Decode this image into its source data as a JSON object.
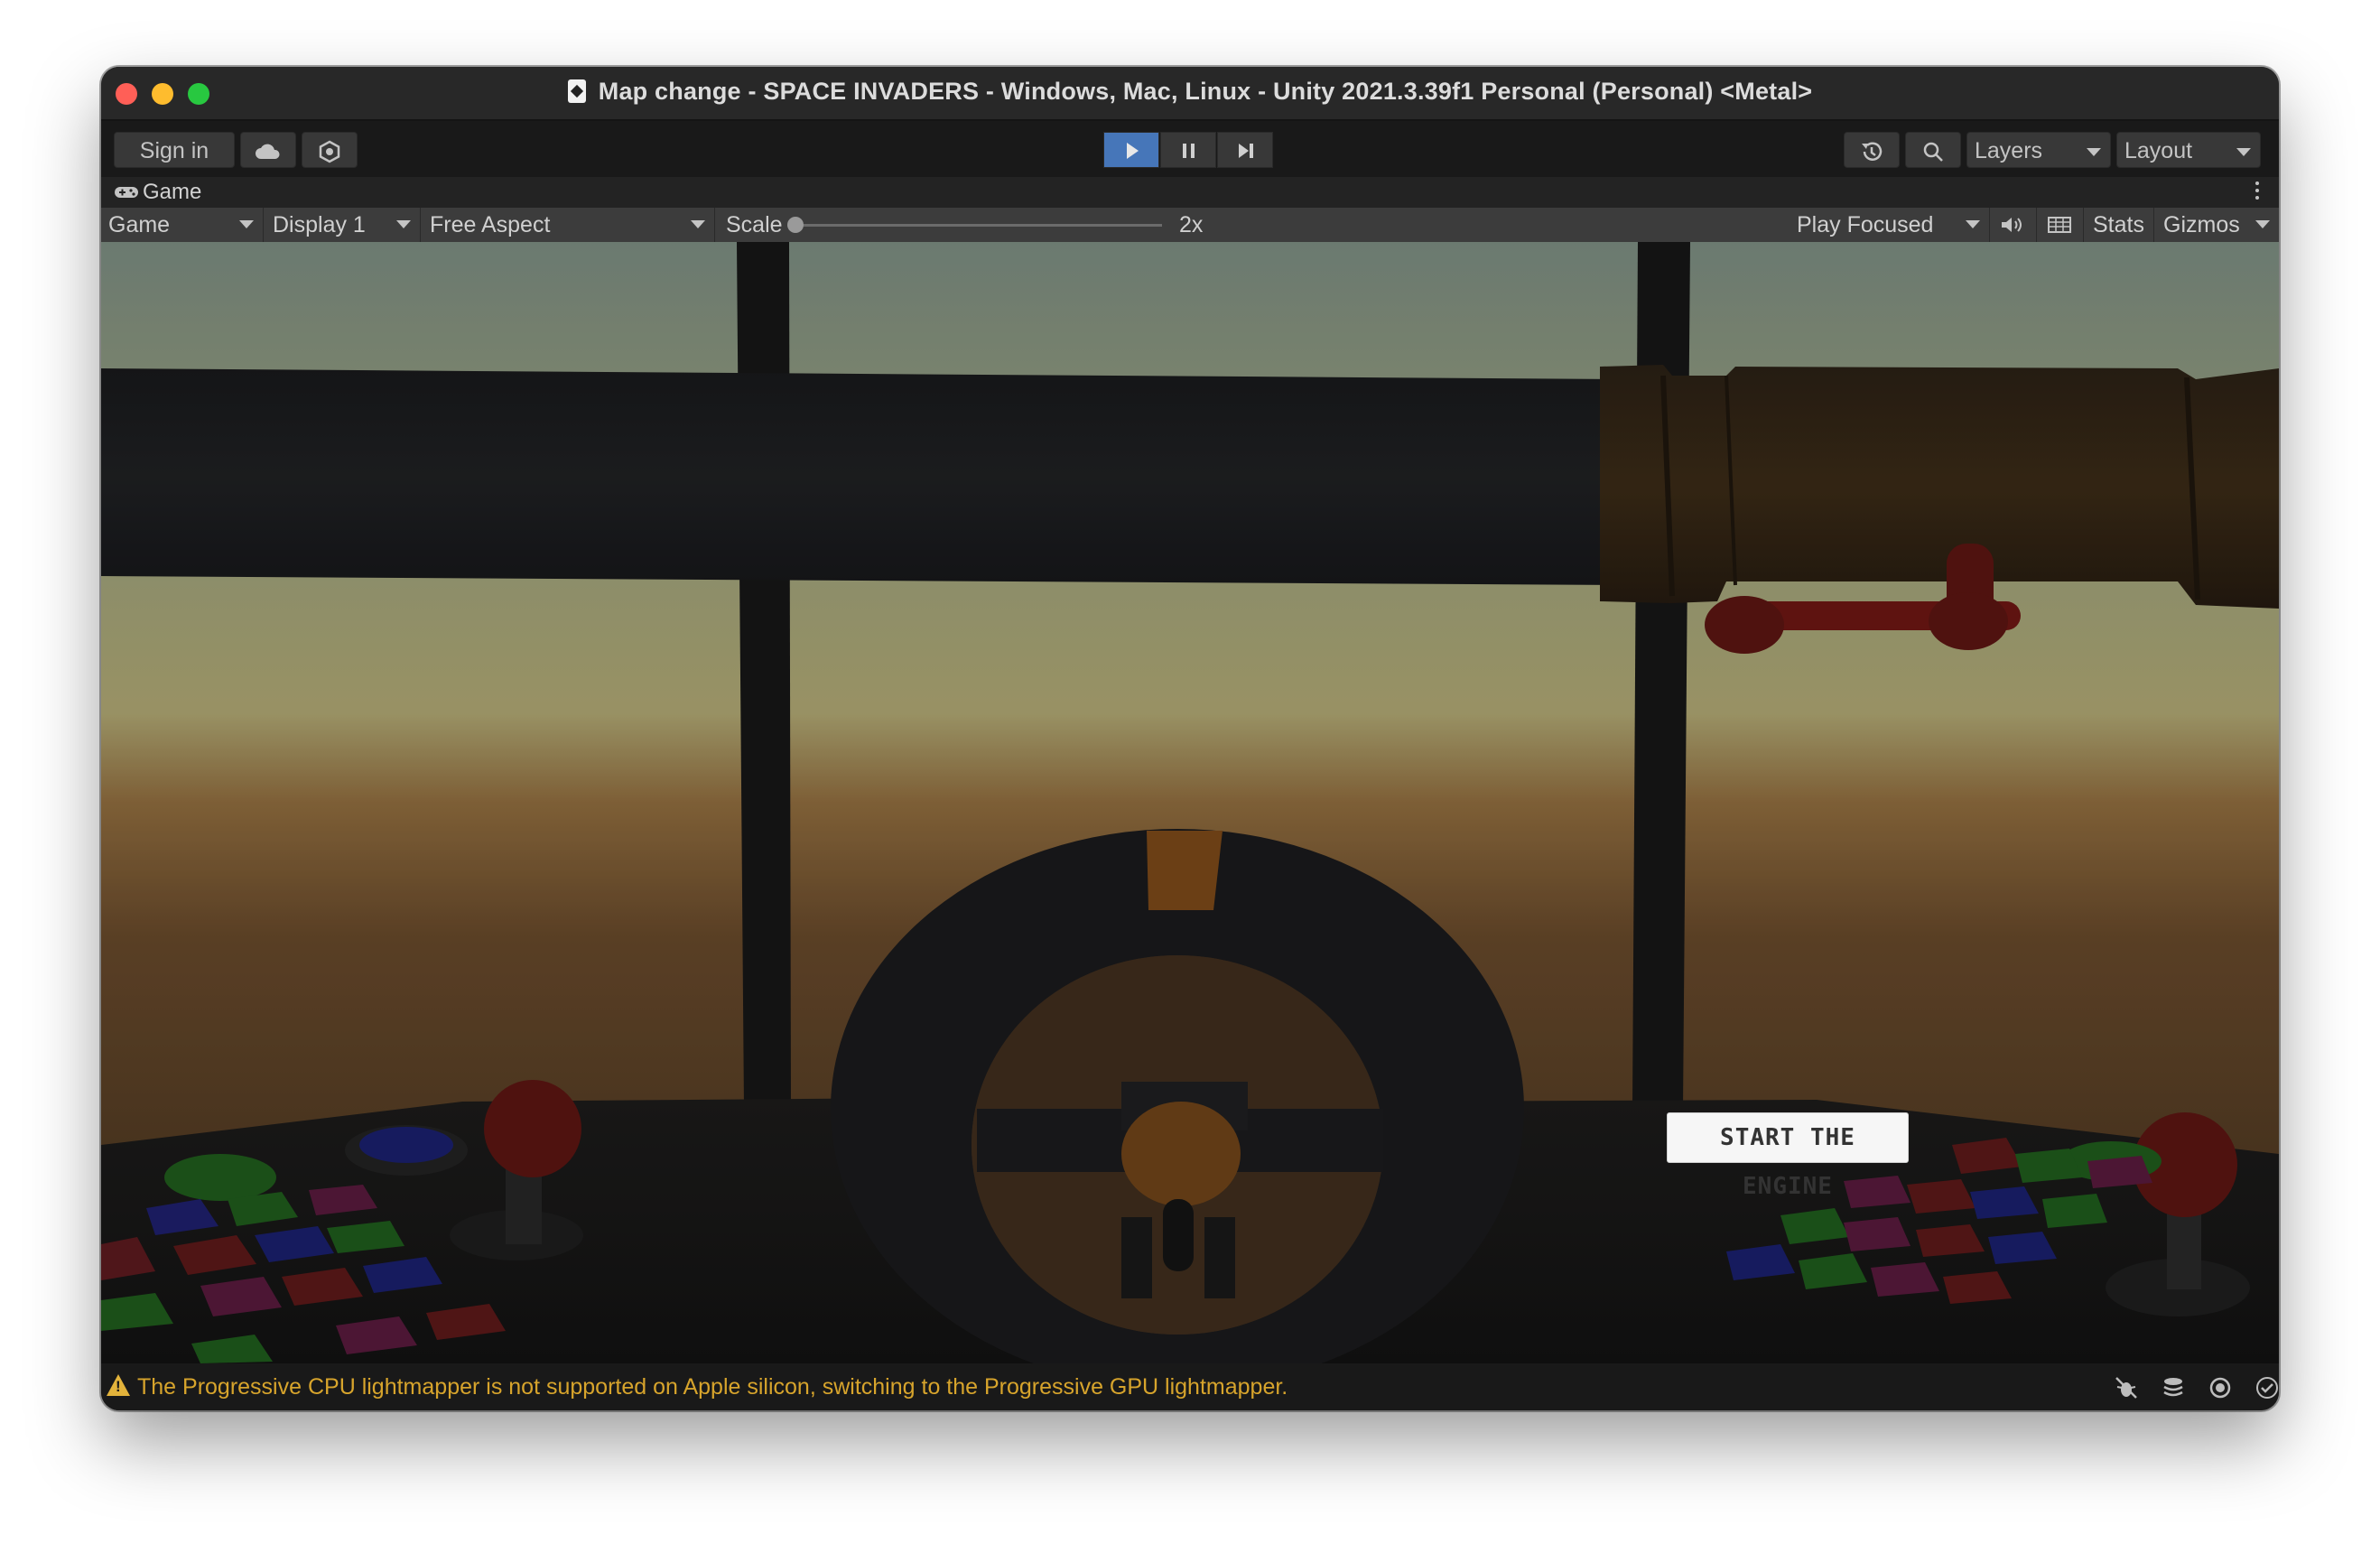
{
  "window": {
    "title": "Map change - SPACE INVADERS - Windows, Mac, Linux - Unity 2021.3.39f1 Personal (Personal) <Metal>"
  },
  "toolbar": {
    "sign_in_label": "Sign in",
    "cloud_icon": "cloud-icon",
    "collab_icon": "collab-icon",
    "play_icon": "play-icon",
    "pause_icon": "pause-icon",
    "step_icon": "step-icon",
    "history_icon": "history-icon",
    "search_icon": "search-icon",
    "layers_label": "Layers",
    "layout_label": "Layout",
    "play_active_color": "#4676b9"
  },
  "game_tab": {
    "label": "Game",
    "icon": "gamepad-icon"
  },
  "game_toolbar": {
    "mode": "Game",
    "display": "Display 1",
    "aspect": "Free Aspect",
    "scale_label": "Scale",
    "scale_value": "2x",
    "play_mode": "Play Focused",
    "mute_icon": "audio-icon",
    "grid_icon": "grid-icon",
    "stats_label": "Stats",
    "gizmos_label": "Gizmos"
  },
  "scene": {
    "start_button_label": "START THE ENGINE"
  },
  "status": {
    "message": "The Progressive CPU lightmapper is not supported on Apple silicon, switching to the Progressive GPU lightmapper.",
    "warning_color": "#d7a42c",
    "icons": [
      "bug-off-icon",
      "layers-stack-icon",
      "lighting-icon",
      "check-circle-icon"
    ]
  }
}
